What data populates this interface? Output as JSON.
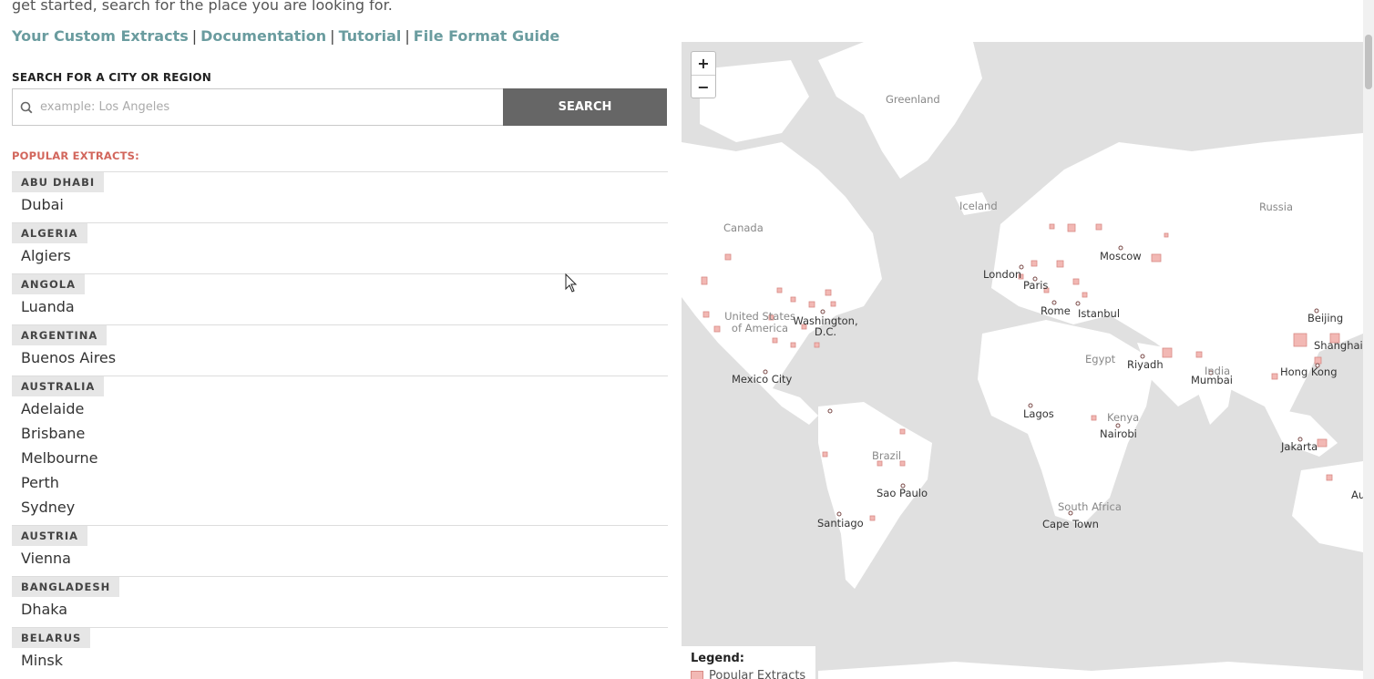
{
  "intro_text": "get started, search for the place you are looking for.",
  "nav_links": [
    "Your Custom Extracts",
    "Documentation",
    "Tutorial",
    "File Format Guide"
  ],
  "search": {
    "label": "SEARCH FOR A CITY OR REGION",
    "placeholder": "example: Los Angeles",
    "value": "",
    "button_label": "SEARCH"
  },
  "popular_title": "POPULAR EXTRACTS:",
  "extracts": [
    {
      "country": "ABU DHABI",
      "cities": [
        "Dubai"
      ]
    },
    {
      "country": "ALGERIA",
      "cities": [
        "Algiers"
      ]
    },
    {
      "country": "ANGOLA",
      "cities": [
        "Luanda"
      ]
    },
    {
      "country": "ARGENTINA",
      "cities": [
        "Buenos Aires"
      ]
    },
    {
      "country": "AUSTRALIA",
      "cities": [
        "Adelaide",
        "Brisbane",
        "Melbourne",
        "Perth",
        "Sydney"
      ]
    },
    {
      "country": "AUSTRIA",
      "cities": [
        "Vienna"
      ]
    },
    {
      "country": "BANGLADESH",
      "cities": [
        "Dhaka"
      ]
    },
    {
      "country": "BELARUS",
      "cities": [
        "Minsk"
      ]
    }
  ],
  "map": {
    "zoom_in": "+",
    "zoom_out": "−",
    "labels": [
      "Greenland",
      "Iceland",
      "Russia",
      "Canada",
      "Moscow",
      "London",
      "Paris",
      "Rome",
      "Istanbul",
      "Beijing",
      "United States of America",
      "Washington, D.C.",
      "Shanghai",
      "Egypt",
      "Riyadh",
      "India",
      "Mumbai",
      "Hong Kong",
      "Mexico City",
      "Lagos",
      "Kenya",
      "Nairobi",
      "Brazil",
      "Sao Paulo",
      "Jakarta",
      "South Africa",
      "Cape Town",
      "Santiago",
      "Au"
    ],
    "legend_title": "Legend:",
    "legend_item": "Popular Extracts"
  },
  "colors": {
    "link": "#6a9c9f",
    "accent": "#d2665c",
    "search_button": "#666666",
    "map_water": "#e0e0e0",
    "map_land": "#ffffff",
    "marker": "#f2b8b4"
  }
}
